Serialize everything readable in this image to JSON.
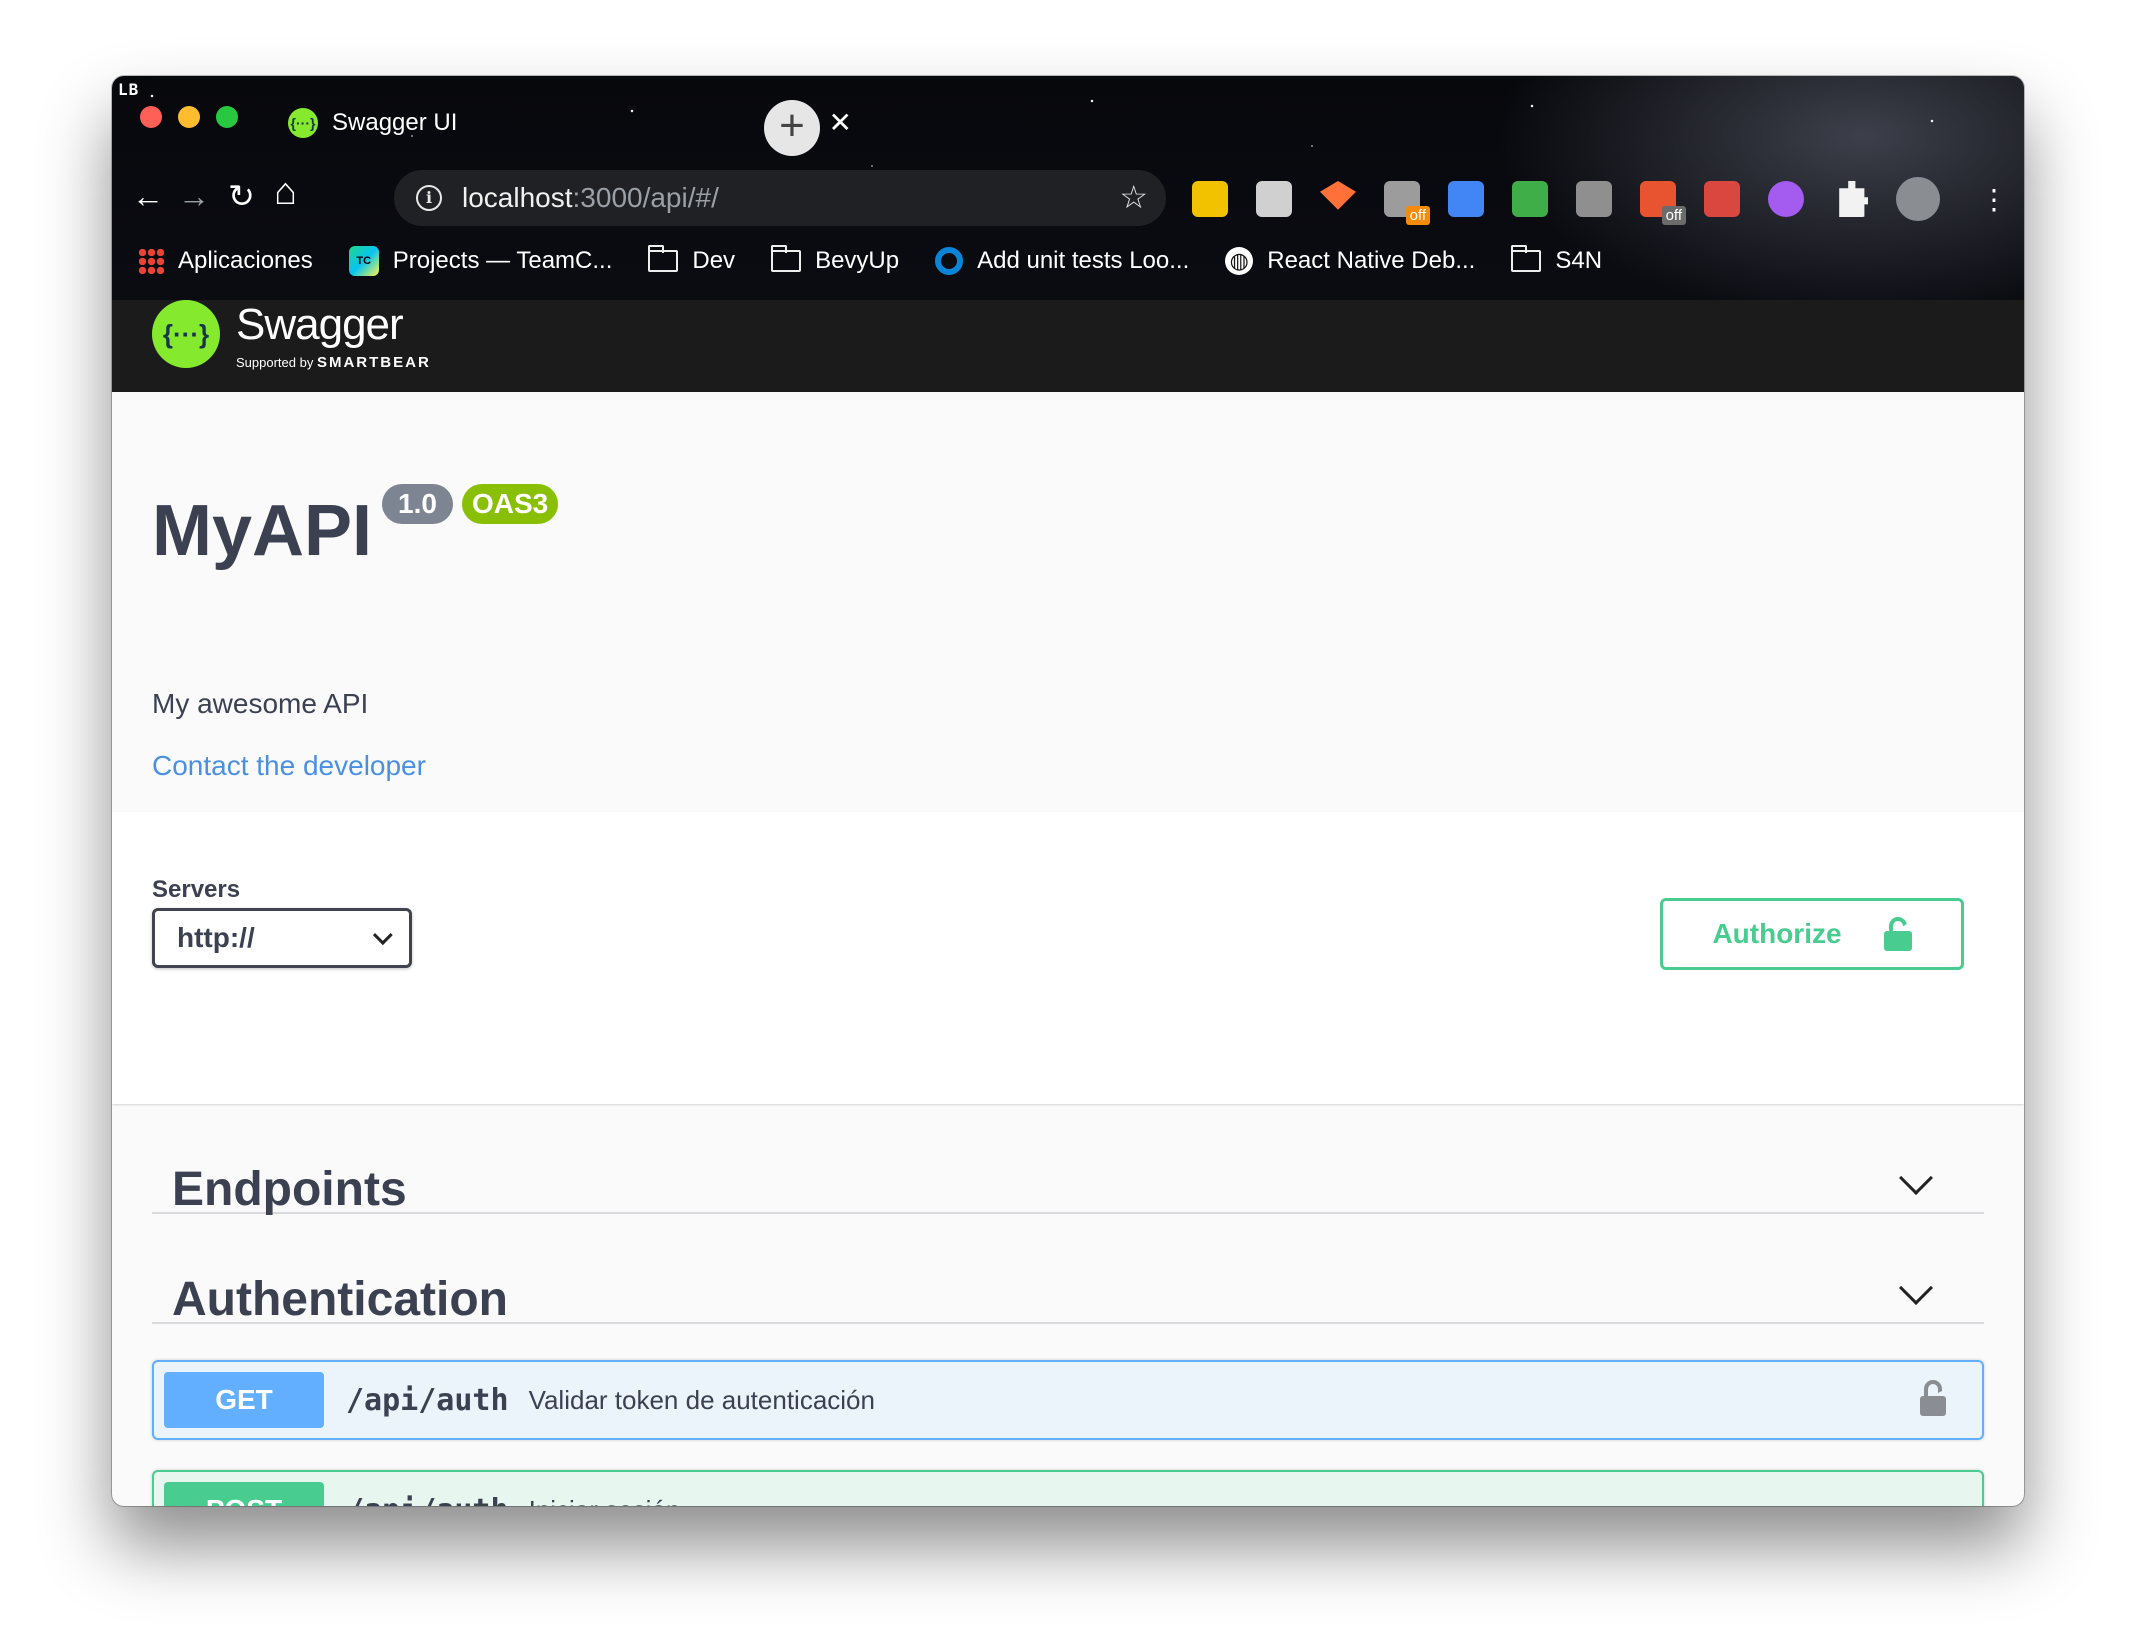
{
  "browser": {
    "brand_mark": "LB",
    "tab": {
      "title": "Swagger UI",
      "favicon_glyph": "{···}",
      "close_glyph": "✕"
    },
    "new_tab_glyph": "+",
    "nav": {
      "back_glyph": "←",
      "forward_glyph": "→",
      "reload_glyph": "↻",
      "home_glyph": "⌂"
    },
    "address": {
      "info_glyph": "i",
      "host": "localhost",
      "path": ":3000/api/#/",
      "star_glyph": "☆"
    },
    "extensions": [
      {
        "name": "pencil-extension-icon",
        "color": "#f2c200",
        "badge": ""
      },
      {
        "name": "ghost-extension-icon",
        "color": "#d0d0d0",
        "badge": ""
      },
      {
        "name": "fox-extension-icon",
        "color": "#ff7139",
        "badge": ""
      },
      {
        "name": "mountain-extension-icon",
        "color": "#9c9c9c",
        "badge": "off",
        "badge_color": "#f48b0b"
      },
      {
        "name": "dropper-extension-icon",
        "color": "#4285f4",
        "badge": ""
      },
      {
        "name": "cube-extension-icon",
        "color": "#3fae49",
        "badge": ""
      },
      {
        "name": "cf-extension-icon",
        "color": "#8f8f8f",
        "badge": ""
      },
      {
        "name": "ccm-extension-icon",
        "color": "#e8542f",
        "badge": "off",
        "badge_color": "#6b6b6b"
      },
      {
        "name": "book-extension-icon",
        "color": "#d9473e",
        "badge": ""
      },
      {
        "name": "dots-extension-icon",
        "color": "#a35bf0",
        "badge": ""
      },
      {
        "name": "puzzle-extension-icon",
        "color": "#f2f2f2",
        "badge": ""
      }
    ],
    "menu_glyph": "⋮",
    "bookmarks": [
      {
        "label": "Aplicaciones",
        "icon": "apps-grid-icon"
      },
      {
        "label": "Projects — TeamC...",
        "icon": "teamcity-icon"
      },
      {
        "label": "Dev",
        "icon": "folder-icon"
      },
      {
        "label": "BevyUp",
        "icon": "folder-icon"
      },
      {
        "label": "Add unit tests Loo...",
        "icon": "ring-icon"
      },
      {
        "label": "React Native Deb...",
        "icon": "globe-icon"
      },
      {
        "label": "S4N",
        "icon": "folder-icon"
      }
    ]
  },
  "swagger": {
    "logo_glyph": "{···}",
    "logo_text": "Swagger",
    "supported_by": "Supported by",
    "smartbear": "SMARTBEAR",
    "title": "MyAPI",
    "version": "1.0",
    "oas": "OAS3",
    "description": "My awesome API",
    "contact": "Contact the developer",
    "servers_label": "Servers",
    "servers_selected": "http://",
    "authorize_label": "Authorize",
    "tags": [
      {
        "name": "Endpoints"
      },
      {
        "name": "Authentication"
      }
    ],
    "operations": [
      {
        "method": "GET",
        "path": "/api/auth",
        "summary": "Validar token de autenticación",
        "color": "#61affe"
      },
      {
        "method": "POST",
        "path": "/api/auth",
        "summary": "Iniciar sesión",
        "color": "#49cc90"
      }
    ],
    "colors": {
      "accent_green": "#85ea2d",
      "get": "#61affe",
      "post": "#49cc90",
      "text": "#3b4151",
      "link": "#4990e2"
    }
  }
}
